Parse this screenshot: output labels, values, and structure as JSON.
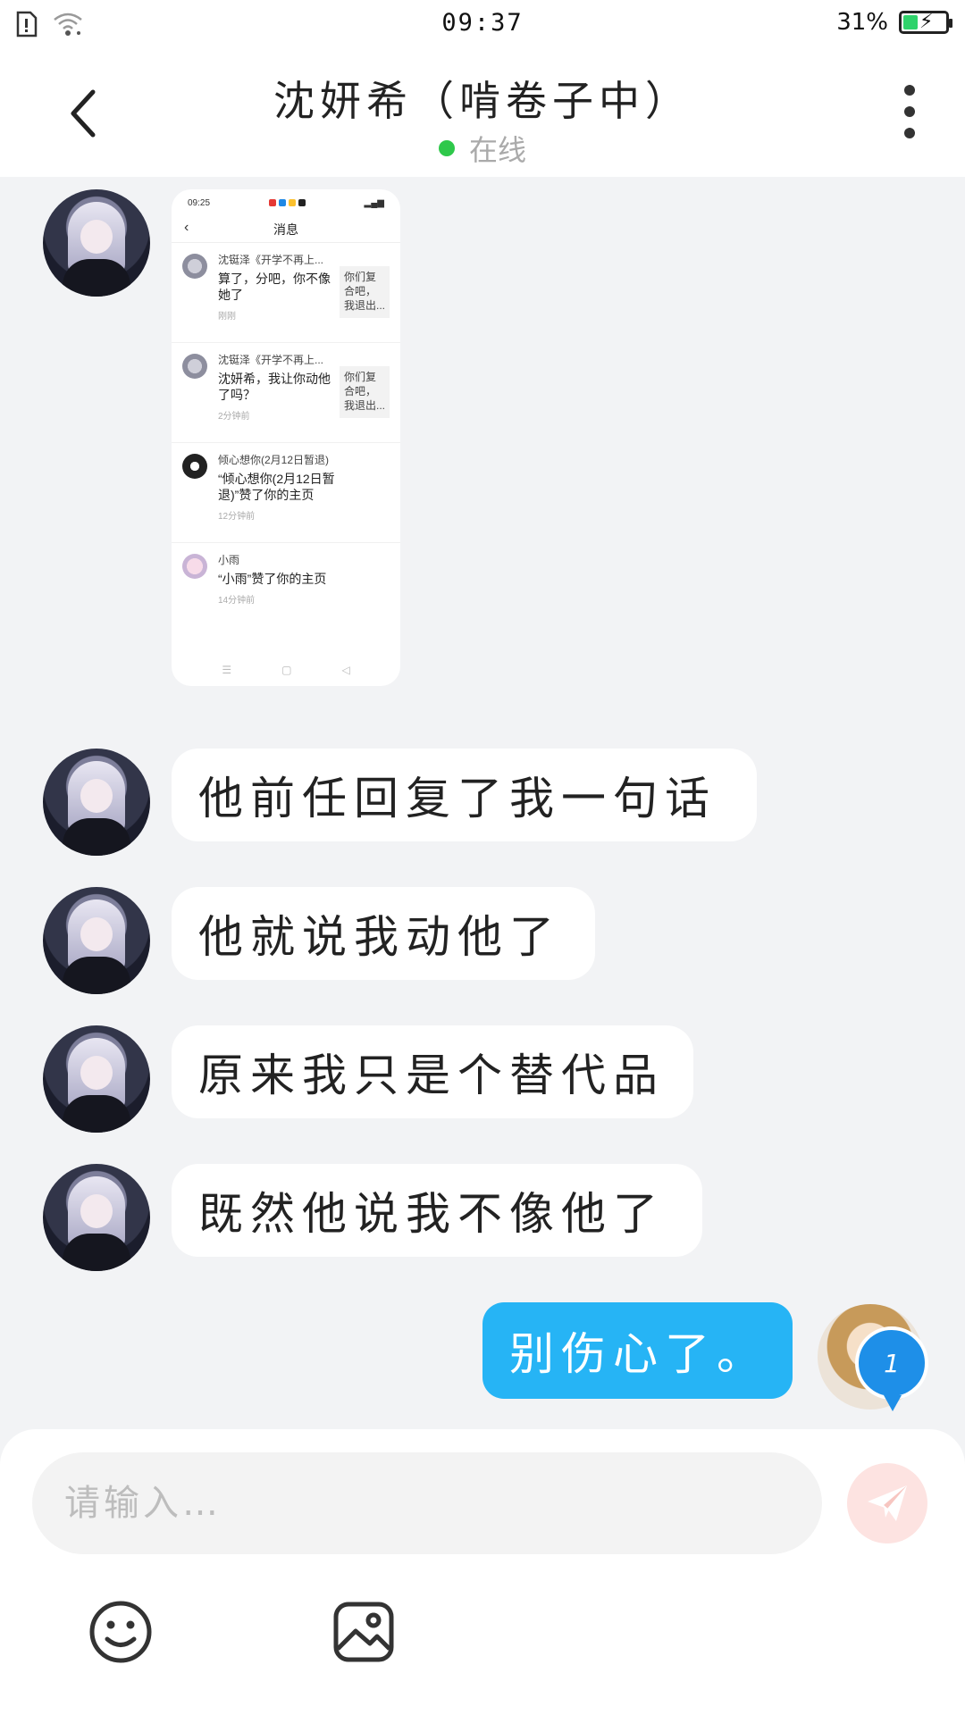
{
  "status_bar": {
    "time": "09:37",
    "battery_text": "31%",
    "icons": [
      "sim-alert-icon",
      "wifi-icon",
      "battery-charging-icon"
    ]
  },
  "header": {
    "title": "沈妍希（啃卷子中）",
    "status_text": "在线",
    "back_icon": "chevron-left-icon",
    "more_icon": "more-vertical-icon"
  },
  "messages": [
    {
      "type": "image",
      "from": "them",
      "screenshot": {
        "time": "09:25",
        "title": "消息",
        "items": [
          {
            "name": "沈铤泽《开学不再上...",
            "msg": "算了，分吧，你不像她了",
            "time": "刚刚",
            "quote": "你们复合吧，我退出..."
          },
          {
            "name": "沈铤泽《开学不再上...",
            "msg": "沈妍希，我让你动他了吗？",
            "time": "2分钟前",
            "quote": "你们复合吧，我退出..."
          },
          {
            "name": "倾心想你(2月12日暂退)",
            "msg": "“倾心想你(2月12日暂退)”赞了你的主页",
            "time": "12分钟前"
          },
          {
            "name": "小雨",
            "msg": "“小雨”赞了你的主页",
            "time": "14分钟前"
          }
        ]
      }
    },
    {
      "type": "text",
      "from": "them",
      "text": "他前任回复了我一句话"
    },
    {
      "type": "text",
      "from": "them",
      "text": "他就说我动他了"
    },
    {
      "type": "text",
      "from": "them",
      "text": "原来我只是个替代品"
    },
    {
      "type": "text",
      "from": "them",
      "text": "既然他说我不像他了"
    },
    {
      "type": "text",
      "from": "me",
      "text": "别伤心了。"
    }
  ],
  "my_badge": "1",
  "composer": {
    "placeholder": "请输入…",
    "send_icon": "send-icon",
    "emoji_icon": "emoji-icon",
    "image_icon": "image-icon"
  },
  "colors": {
    "my_bubble": "#26b4f5",
    "online_dot": "#2ec84a",
    "background": "#f2f3f5",
    "send_button": "#fde3e1"
  }
}
